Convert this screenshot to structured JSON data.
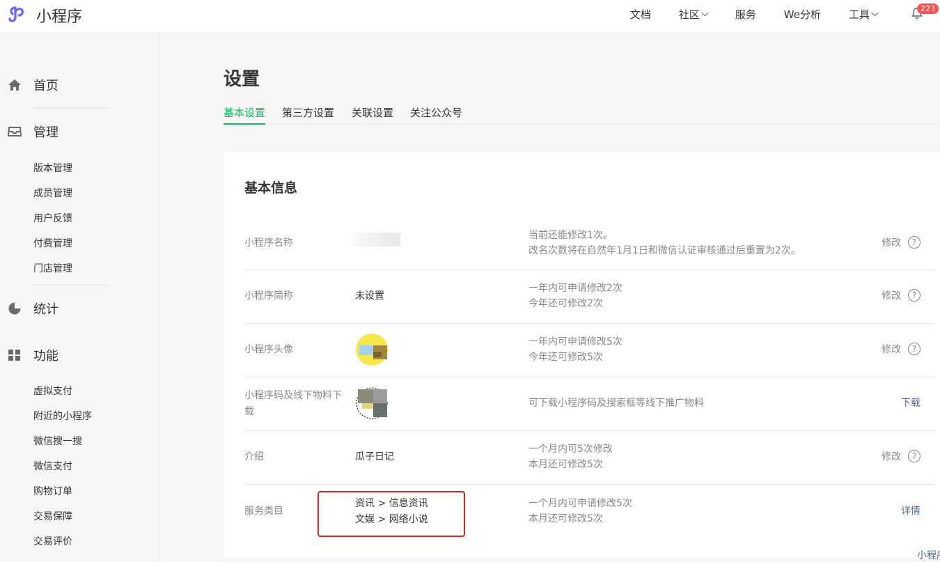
{
  "header": {
    "brand": "小程序",
    "nav": [
      {
        "label": "文档",
        "dropdown": false
      },
      {
        "label": "社区",
        "dropdown": true
      },
      {
        "label": "服务",
        "dropdown": false
      },
      {
        "label": "We分析",
        "dropdown": false
      },
      {
        "label": "工具",
        "dropdown": true
      }
    ],
    "notification_count": "223",
    "accent_color": "#07c160",
    "logo_color": "#6467f0"
  },
  "sidebar": {
    "home": {
      "label": "首页",
      "icon": "home-icon"
    },
    "manage": {
      "label": "管理",
      "icon": "inbox-icon",
      "items": [
        "版本管理",
        "成员管理",
        "用户反馈",
        "付费管理",
        "门店管理"
      ]
    },
    "stats": {
      "label": "统计",
      "icon": "pie-chart-icon"
    },
    "features": {
      "label": "功能",
      "icon": "grid-icon",
      "items": [
        "虚拟支付",
        "附近的小程序",
        "微信搜一搜",
        "微信支付",
        "购物订单",
        "交易保障",
        "交易评价"
      ]
    }
  },
  "main": {
    "title": "设置",
    "tabs": [
      "基本设置",
      "第三方设置",
      "关联设置",
      "关注公众号"
    ],
    "active_tab": "基本设置",
    "section_title": "基本信息",
    "rows": [
      {
        "label": "小程序名称",
        "value": "",
        "desc": [
          "当前还能修改1次。",
          "改名次数将在自然年1月1日和微信认证审核通过后重置为2次。"
        ],
        "action": "修改",
        "help": true
      },
      {
        "label": "小程序简称",
        "value": "未设置",
        "desc": [
          "一年内可申请修改2次",
          "今年还可修改2次"
        ],
        "action": "修改",
        "help": true
      },
      {
        "label": "小程序头像",
        "value": "",
        "desc": [
          "一年内可申请修改5次",
          "今年还可修改5次"
        ],
        "action": "修改",
        "help": true
      },
      {
        "label": "小程序码及线下物料下载",
        "value": "",
        "desc": [
          "可下载小程序码及搜索框等线下推广物料"
        ],
        "action": "下载",
        "help": false
      },
      {
        "label": "介绍",
        "value": "瓜子日记",
        "desc": [
          "一个月内可5次修改",
          "本月还可修改5次"
        ],
        "action": "修改",
        "help": true
      },
      {
        "label": "服务类目",
        "value": [
          "资讯 > 信息资讯",
          "文娱 > 网络小说"
        ],
        "desc": [
          "一个月内可申请修改5次",
          "本月还可修改5次"
        ],
        "action": "详情",
        "help": false
      }
    ],
    "footer_link": "小程序主体变更"
  }
}
